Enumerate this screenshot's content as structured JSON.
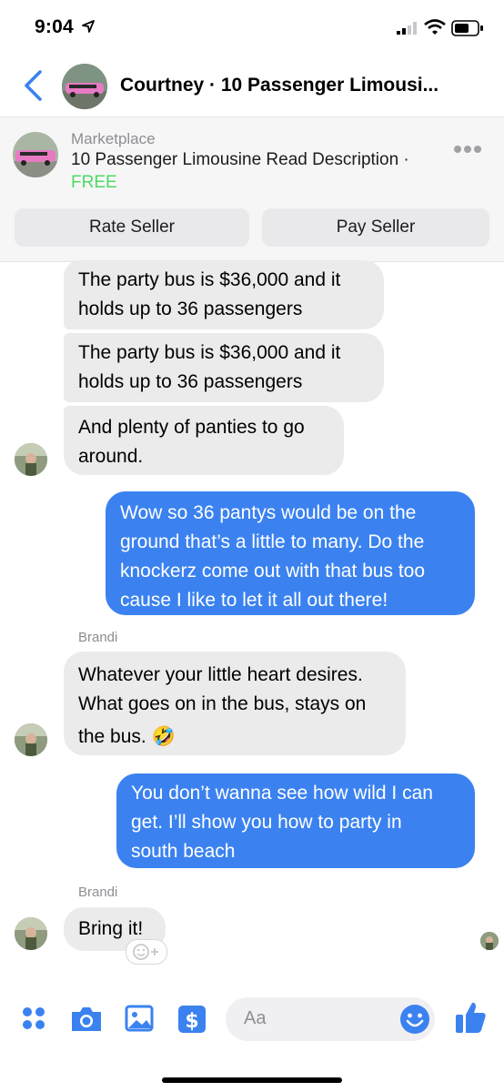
{
  "status_bar": {
    "time": "9:04"
  },
  "header": {
    "title": "Courtney · 10 Passenger Limousi..."
  },
  "marketplace": {
    "label": "Marketplace",
    "title": "10 Passenger Limousine Read Description ·",
    "price": "FREE",
    "rate_button": "Rate Seller",
    "pay_button": "Pay Seller"
  },
  "messages": [
    {
      "from": "Brandi",
      "direction": "in",
      "lines": [
        "The party bus is $36,000 and it",
        "holds up to 36 passengers"
      ]
    },
    {
      "from": "Brandi",
      "direction": "in",
      "lines": [
        "The party bus is $36,000 and it",
        "holds up to 36 passengers"
      ]
    },
    {
      "from": "Brandi",
      "direction": "in",
      "lines": [
        "And plenty of panties to go",
        "around."
      ]
    },
    {
      "from": "me",
      "direction": "out",
      "lines": [
        "Wow so 36 pantys would be on the",
        "ground that’s a little to many. Do the",
        "knockerz come out with that bus too",
        "cause I like to let it all out there!"
      ]
    },
    {
      "from": "Brandi",
      "direction": "in",
      "sender_label": "Brandi",
      "lines": [
        "Whatever your little heart desires.",
        "What goes on in the bus, stays on",
        "the bus. 🤣"
      ]
    },
    {
      "from": "me",
      "direction": "out",
      "lines": [
        "You don’t wanna see how wild I can",
        "get. I’ll show you how to party in",
        "south beach"
      ]
    },
    {
      "from": "Brandi",
      "direction": "in",
      "sender_label": "Brandi",
      "lines": [
        "Bring it!"
      ]
    }
  ],
  "composer": {
    "placeholder": "Aa"
  },
  "colors": {
    "accent": "#3b82f0",
    "incoming_bubble": "#ebebec",
    "price": "#4cd964"
  },
  "icons": [
    "location-arrow-icon",
    "signal-icon",
    "wifi-icon",
    "battery-icon",
    "back-chevron-icon",
    "more-dots-icon",
    "apps-icon",
    "camera-icon",
    "gallery-icon",
    "payment-icon",
    "emoji-icon",
    "thumbs-up-icon",
    "add-reaction-icon"
  ]
}
